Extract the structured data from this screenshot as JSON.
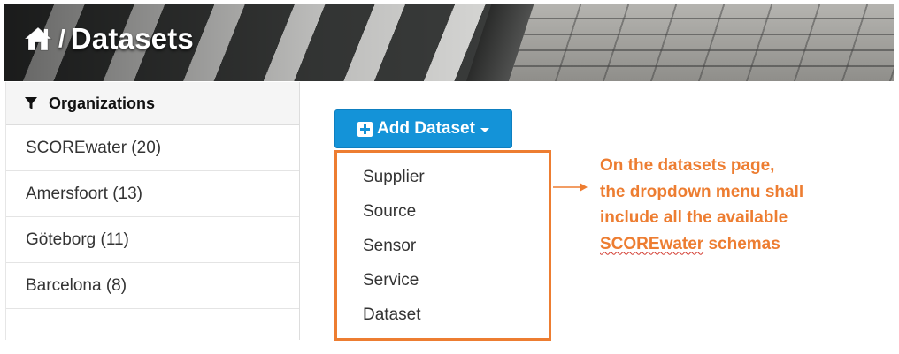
{
  "header": {
    "separator": "/",
    "title": "Datasets"
  },
  "sidebar": {
    "heading": "Organizations",
    "items": [
      {
        "label": "SCOREwater (20)"
      },
      {
        "label": "Amersfoort (13)"
      },
      {
        "label": "Göteborg (11)"
      },
      {
        "label": "Barcelona (8)"
      }
    ]
  },
  "add_dataset": {
    "label": "Add Dataset",
    "menu": [
      "Supplier",
      "Source",
      "Sensor",
      "Service",
      "Dataset"
    ]
  },
  "annotation": {
    "line1": "On the datasets page,",
    "line2": "the dropdown menu shall",
    "line3": "include all the available",
    "line4_word": "SCOREwater",
    "line4_rest": " schemas"
  },
  "colors": {
    "accent_button": "#1493d8",
    "annotation": "#ed7d31"
  }
}
